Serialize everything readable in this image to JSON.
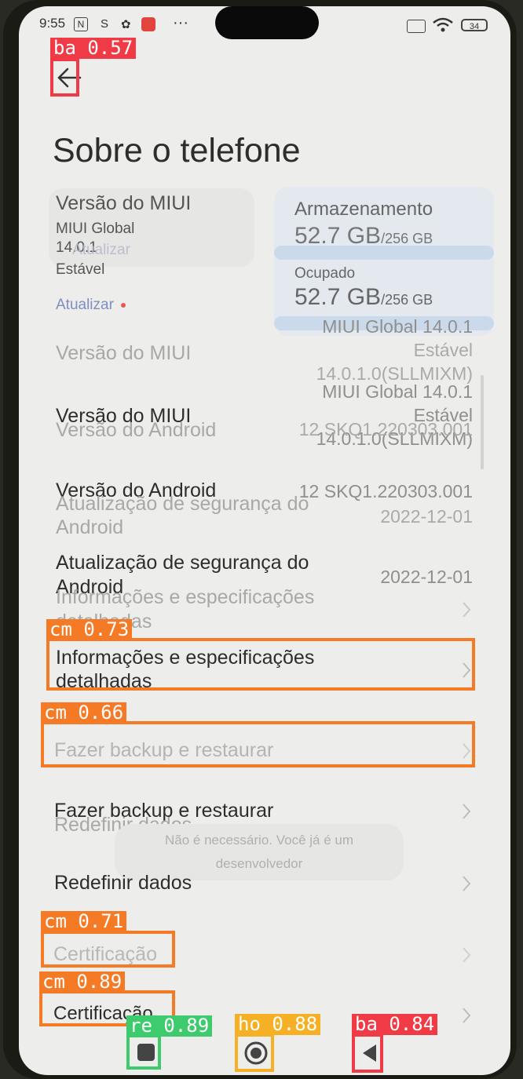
{
  "status_bar": {
    "time": "9:55",
    "nfc_icon": "N",
    "sync_icon": "S",
    "gear_icon": "✿",
    "more_dots": "···",
    "battery": "34"
  },
  "page": {
    "title": "Sobre o telefone",
    "info_card": {
      "label": "Versão do MIUI",
      "version_line1": "MIUI Global",
      "version_line2": "14.0.1",
      "channel": "Estável",
      "update_link": "Atualizar",
      "update_ghost": "Atualizar"
    },
    "storage_card": {
      "label": "Armazenamento",
      "total_value": "52.7 GB",
      "total_of": "/256 GB",
      "used_label": "Ocupado",
      "used_value": "52.7 GB",
      "used_of": "/256 GB"
    },
    "rows": {
      "update_link": "Atualizar",
      "miui_label": "Versão do MIUI",
      "miui_value_1": "MIUI Global 14.0.1",
      "miui_value_2": "Estável",
      "miui_value_3": "14.0.1.0(SLLMIXM)",
      "android_label": "Versão do Android",
      "android_value": "12 SKQ1.220303.001",
      "security_label_1": "Atualização de segurança do",
      "security_label_2": "Android",
      "security_value": "2022-12-01",
      "details_label_1": "Informações e especificações",
      "details_label_2": "detalhadas",
      "backup_label": "Fazer backup e restaurar",
      "reset_label": "Redefinir dados",
      "cert_label": "Certificação"
    },
    "toast": {
      "line1": "Não é necessário. Você já é um",
      "line2": "desenvolvedor"
    }
  },
  "detections": [
    {
      "tag": "ba 0.57",
      "color": "#f03a46"
    },
    {
      "tag": "cm 0.73",
      "color": "#f57a25"
    },
    {
      "tag": "cm 0.66",
      "color": "#f57a25"
    },
    {
      "tag": "cm 0.71",
      "color": "#f57a25"
    },
    {
      "tag": "cm 0.89",
      "color": "#f57a25"
    },
    {
      "tag": "re 0.89",
      "color": "#3ecb6e"
    },
    {
      "tag": "ho 0.88",
      "color": "#f5b025"
    },
    {
      "tag": "ba 0.84",
      "color": "#f03a46"
    }
  ],
  "icons": {
    "back": "arrow-left-icon",
    "chevron": "chevron-right-icon",
    "recents": "square-icon",
    "home": "circle-icon",
    "nav_back": "triangle-left-icon"
  }
}
